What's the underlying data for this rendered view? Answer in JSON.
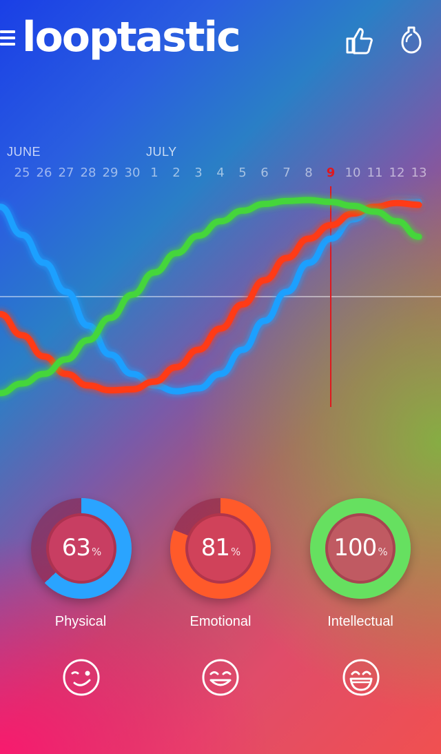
{
  "app": {
    "logo": "looptastic"
  },
  "header": {
    "menu_icon": "hamburger-menu-icon",
    "like_icon": "thumbs-up-icon",
    "tip_icon": "light-bulb-icon"
  },
  "calendar": {
    "months": [
      "JUNE",
      "JULY"
    ],
    "days": [
      "25",
      "26",
      "27",
      "28",
      "29",
      "30",
      "1",
      "2",
      "3",
      "4",
      "5",
      "6",
      "7",
      "8",
      "9",
      "10",
      "11",
      "12",
      "13"
    ],
    "today": "9"
  },
  "chart_data": {
    "type": "line",
    "x": [
      "25",
      "26",
      "27",
      "28",
      "29",
      "30",
      "1",
      "2",
      "3",
      "4",
      "5",
      "6",
      "7",
      "8",
      "9",
      "10",
      "11",
      "12",
      "13"
    ],
    "ylim": [
      -1,
      1
    ],
    "series": [
      {
        "color": "#1ea0ff",
        "values": [
          0.64,
          0.35,
          0.05,
          -0.3,
          -0.6,
          -0.8,
          -0.92,
          -0.98,
          -0.95,
          -0.8,
          -0.55,
          -0.25,
          0.05,
          0.35,
          0.6,
          0.8,
          0.92,
          0.98,
          0.98
        ]
      },
      {
        "color": "#ff3b12",
        "values": [
          -0.4,
          -0.62,
          -0.8,
          -0.92,
          -0.97,
          -0.96,
          -0.88,
          -0.73,
          -0.55,
          -0.33,
          -0.08,
          0.17,
          0.4,
          0.6,
          0.74,
          0.86,
          0.93,
          0.97,
          0.95
        ]
      },
      {
        "color": "#44d63a",
        "values": [
          -0.9,
          -0.8,
          -0.65,
          -0.45,
          -0.22,
          0.02,
          0.25,
          0.45,
          0.63,
          0.78,
          0.89,
          0.96,
          0.99,
          1.0,
          0.98,
          0.94,
          0.88,
          0.78,
          0.62
        ]
      }
    ],
    "today_marker": "9"
  },
  "gauges": [
    {
      "value": "63",
      "percent": 63,
      "unit": "%",
      "label": "Physical",
      "color": "#2aa4ff",
      "face_icon": "winking-face-icon"
    },
    {
      "value": "81",
      "percent": 81,
      "unit": "%",
      "label": "Emotional",
      "color": "#ff5a2a",
      "face_icon": "grinning-face-icon"
    },
    {
      "value": "100",
      "percent": 100,
      "unit": "%",
      "label": "Intellectual",
      "color": "#66e060",
      "face_icon": "laughing-face-icon"
    }
  ]
}
